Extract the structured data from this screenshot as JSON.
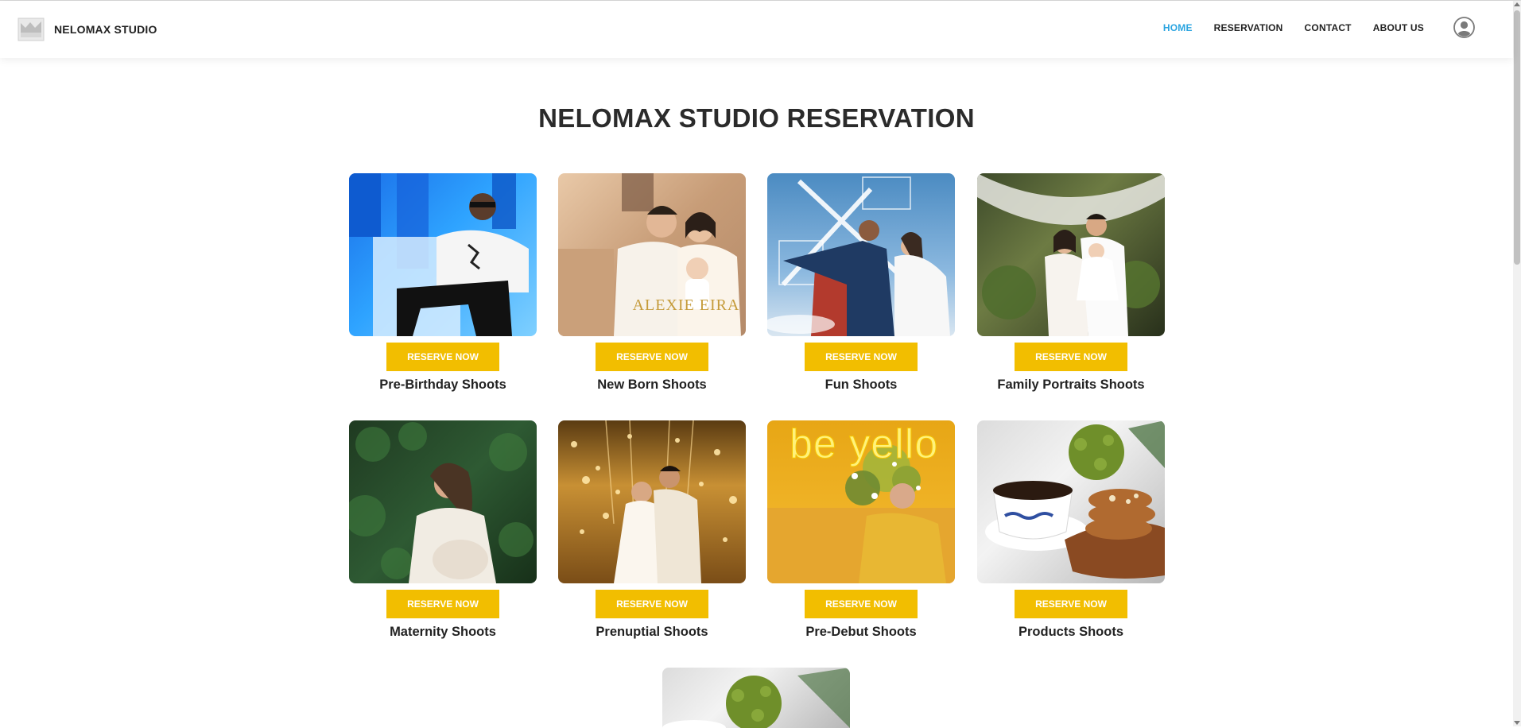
{
  "brand": {
    "name": "NELOMAX STUDIO"
  },
  "nav": {
    "items": [
      {
        "label": "HOME",
        "active": true
      },
      {
        "label": "RESERVATION",
        "active": false
      },
      {
        "label": "CONTACT",
        "active": false
      },
      {
        "label": "ABOUT US",
        "active": false
      }
    ]
  },
  "page": {
    "title": "NELOMAX STUDIO RESERVATION"
  },
  "cards": [
    {
      "title": "Pre-Birthday Shoots",
      "button": "RESERVE NOW"
    },
    {
      "title": "New Born Shoots",
      "button": "RESERVE NOW",
      "photo_text": "ALEXIE EIRA"
    },
    {
      "title": "Fun Shoots",
      "button": "RESERVE NOW"
    },
    {
      "title": "Family Portraits Shoots",
      "button": "RESERVE NOW"
    },
    {
      "title": "Maternity Shoots",
      "button": "RESERVE NOW"
    },
    {
      "title": "Prenuptial Shoots",
      "button": "RESERVE NOW"
    },
    {
      "title": "Pre-Debut Shoots",
      "button": "RESERVE NOW",
      "photo_text": "be yello"
    },
    {
      "title": "Products Shoots",
      "button": "RESERVE NOW"
    }
  ],
  "colors": {
    "accent": "#f2be00",
    "nav_active": "#2aa4e0",
    "text": "#222222"
  }
}
